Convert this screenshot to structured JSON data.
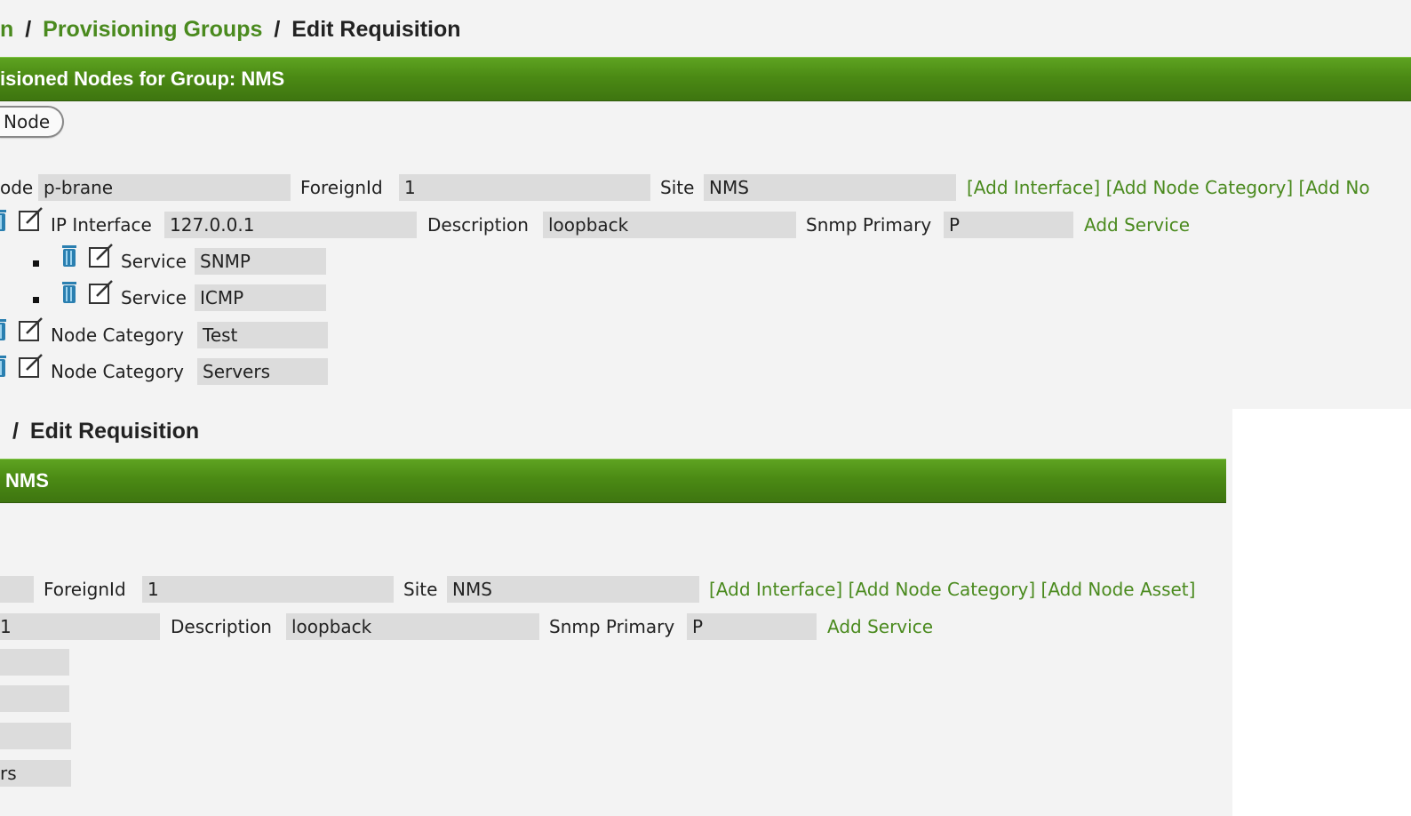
{
  "top": {
    "breadcrumb": {
      "first": "n",
      "sep1": "/",
      "link": "Provisioning Groups",
      "sep2": "/",
      "current": "Edit Requisition"
    },
    "section_title": "isioned Nodes for Group: NMS",
    "add_node_button": "Node",
    "node": {
      "label": "ode",
      "value": "p-brane",
      "foreign_label": "ForeignId",
      "foreign_value": "1",
      "site_label": "Site",
      "site_value": "NMS",
      "links": "[Add Interface] [Add Node Category] [Add No"
    },
    "interface": {
      "label": "IP Interface",
      "value": "127.0.0.1",
      "desc_label": "Description",
      "desc_value": "loopback",
      "snmp_label": "Snmp Primary",
      "snmp_value": "P",
      "add_service": "Add Service"
    },
    "services": [
      {
        "label": "Service",
        "value": "SNMP"
      },
      {
        "label": "Service",
        "value": "ICMP"
      }
    ],
    "categories": [
      {
        "label": "Node Category",
        "value": "Test"
      },
      {
        "label": "Node Category",
        "value": "Servers"
      }
    ]
  },
  "bottom": {
    "breadcrumb": {
      "sep": "/",
      "current": "Edit Requisition"
    },
    "section_title": "NMS",
    "node": {
      "foreign_label": "ForeignId",
      "foreign_value": "1",
      "site_label": "Site",
      "site_value": "NMS",
      "links": "[Add Interface] [Add Node Category] [Add Node Asset]"
    },
    "interface": {
      "value": "1",
      "desc_label": "Description",
      "desc_value": "loopback",
      "snmp_label": "Snmp Primary",
      "snmp_value": "P",
      "add_service": "Add Service"
    },
    "last_category_value": "rs"
  },
  "colors": {
    "accent_green": "#4a8a1e",
    "bar_green": "#4b8a14",
    "field_gray": "#dcdcdc",
    "trash_blue": "#2a7fb0"
  },
  "icons": [
    "trash-icon",
    "edit-icon"
  ]
}
